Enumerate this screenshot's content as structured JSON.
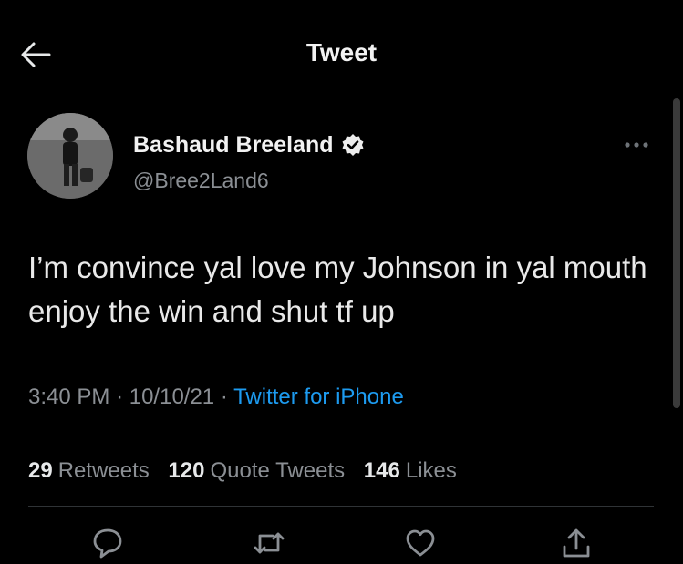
{
  "header": {
    "title": "Tweet"
  },
  "author": {
    "name": "Bashaud Breeland",
    "handle": "@Bree2Land6",
    "verified": true
  },
  "tweet": {
    "text": "I’m convince yal love my Johnson in yal mouth enjoy the win and shut tf up",
    "time": "3:40 PM",
    "date": "10/10/21",
    "source": "Twitter for iPhone"
  },
  "stats": {
    "retweets_count": "29",
    "retweets_label": "Retweets",
    "quote_count": "120",
    "quote_label": "Quote Tweets",
    "likes_count": "146",
    "likes_label": "Likes"
  },
  "icons": [
    "back-arrow-icon",
    "verified-badge-icon",
    "more-icon",
    "reply-icon",
    "retweet-icon",
    "like-icon",
    "share-icon"
  ],
  "colors": {
    "background": "#000000",
    "accent": "#1d9bf0",
    "secondary_text": "#8b8f94"
  }
}
